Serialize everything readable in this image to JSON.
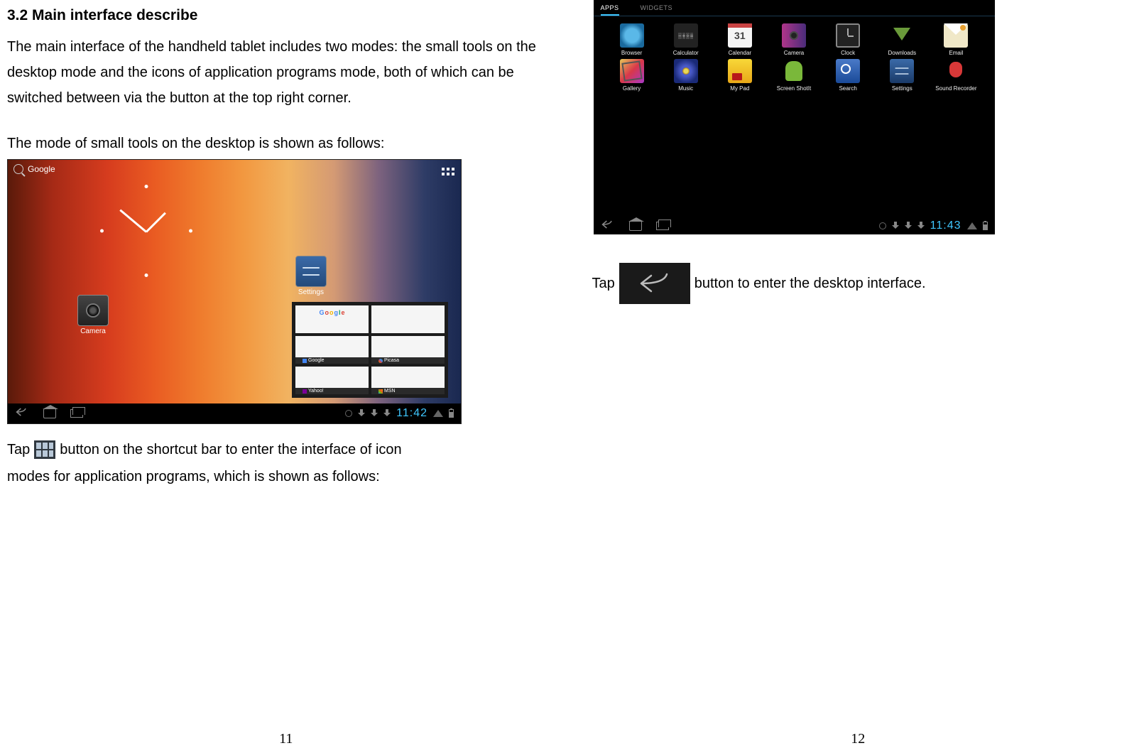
{
  "left": {
    "heading": "3.2 Main interface describe",
    "para1": "The main interface of the handheld tablet includes two modes: the small tools on the desktop mode and the icons of application programs mode, both of which can be switched between via the button at the top right corner.",
    "para2": "The mode of small tools on the desktop is shown as follows:",
    "tap_pre": "Tap",
    "tap_post": "button on the shortcut bar to enter the interface of icon",
    "tap_line2": "modes for application programs, which is shown as follows:",
    "page_num": "11",
    "shot1": {
      "search_label": "Google",
      "camera_label": "Camera",
      "settings_label": "Settings",
      "bookmarks": {
        "google": "Google",
        "picasa": "Picasa",
        "yahoo": "Yahoo!",
        "msn": "MSN"
      },
      "time": "11:42"
    }
  },
  "right": {
    "tap_pre": "Tap",
    "tap_post": "button to enter the desktop interface.",
    "page_num": "12",
    "shot2": {
      "tab_apps": "APPS",
      "tab_widgets": "WIDGETS",
      "apps": {
        "browser": "Browser",
        "calculator": "Calculator",
        "calendar": "Calendar",
        "camera": "Camera",
        "clock": "Clock",
        "downloads": "Downloads",
        "email": "Email",
        "gallery": "Gallery",
        "music": "Music",
        "mypad": "My Pad",
        "screenshot": "Screen ShotIt",
        "search": "Search",
        "settings": "Settings",
        "sound": "Sound Recorder"
      },
      "time": "11:43"
    }
  }
}
